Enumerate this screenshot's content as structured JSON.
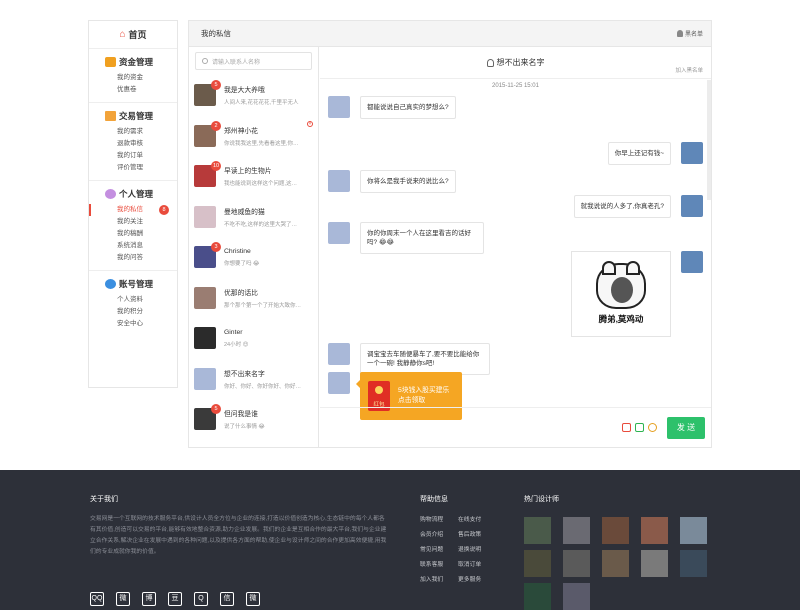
{
  "sidebar": {
    "home": "首页",
    "groups": [
      {
        "title": "资金管理",
        "items": [
          "我的资金",
          "优惠卷"
        ]
      },
      {
        "title": "交易管理",
        "items": [
          "我的需求",
          "退款审核",
          "我的订单",
          "评价管理"
        ]
      },
      {
        "title": "个人管理",
        "items": [
          "我的私信",
          "我的关注",
          "我的稿酬",
          "系统消息",
          "我的问答"
        ],
        "active_index": 0,
        "active_badge": "8"
      },
      {
        "title": "账号管理",
        "items": [
          "个人资料",
          "我的积分",
          "安全中心"
        ]
      }
    ]
  },
  "chat": {
    "header_title": "我的私信",
    "blacklist": "黑名单",
    "search_placeholder": "请输入联系人名称",
    "contacts": [
      {
        "name": "我是大大养哦",
        "preview": "人间人来,花花花花,千里平无人",
        "badge": "5",
        "color": "#6b5b4b"
      },
      {
        "name": "郑州神小花",
        "preview": "你说我我这里,先看看这里,你…",
        "badge": "2",
        "color": "#8a6a58",
        "closable": true
      },
      {
        "name": "早读上的生物片",
        "preview": "我也能说到这样这个问题,这…",
        "badge": "10",
        "color": "#b73a3a"
      },
      {
        "name": "曼地威鱼的猫",
        "preview": "不吃不吃,这样的这里大哭了…",
        "badge": "",
        "color": "#d7c0c8"
      },
      {
        "name": "Christine",
        "preview": "你想要了吗 😂",
        "badge": "3",
        "color": "#4a4e8a"
      },
      {
        "name": "优那的话比",
        "preview": "那个那个第一个了开始大致你…",
        "badge": "",
        "color": "#9a7d72"
      },
      {
        "name": "Ginter",
        "preview": "24小时 😍",
        "badge": "",
        "color": "#2b2b2b"
      },
      {
        "name": "想不出来名字",
        "preview": "你好、你好、你好你好、你好…",
        "badge": "",
        "color": "#a9b8d8"
      },
      {
        "name": "但问我是谁",
        "preview": "说了什么事情 😂",
        "badge": "5",
        "color": "#3a3a3a"
      }
    ],
    "conversation": {
      "title": "想不出来名字",
      "add_contact": "加入黑名单",
      "timestamp": "2015-11-25 15:01",
      "messages": [
        {
          "side": "left",
          "text": "都能说说自己真实的梦想么?"
        },
        {
          "side": "right",
          "text": "你早上还记有钱~"
        },
        {
          "side": "left",
          "text": "你将么是我手说来的说比么?"
        },
        {
          "side": "right",
          "text": "就我说说的人多了,你真老孔?"
        },
        {
          "side": "left",
          "text": "你的你周末一个人在这里看吉的话好吗? 😂😂"
        },
        {
          "side": "right",
          "type": "sticker",
          "caption": "腾弟,莫鸡动"
        },
        {
          "side": "left",
          "text": "调宝宝去车随便暴车了,要不要比能给你一个一碗! 我静静你s吧!"
        },
        {
          "side": "left",
          "type": "redpacket",
          "envelope_label": "红包",
          "text_line1": "5块钱入股买建乐",
          "text_line2": "点击领取"
        }
      ]
    },
    "send_label": "发 送"
  },
  "footer": {
    "about_title": "关于我们",
    "about_text": "交易网是一个互联网的技术服务平台,供设计人员全方位与企业的连接,打造以价值创造为核心,生态链中的每个人都各有其价值,创造可以交易的平台,能够有效地整合资源,助力企业发展。我们的企业是互相合作的最大平台,我们与企业建立合作关系,解决企业在发展中遇到的各种问题,以及提供各方面的帮助,使企业与设计师之间的合作更加高效便捷,用我们的专业成就你我的价值。",
    "socials": [
      "QQ",
      "微",
      "博",
      "豆",
      "Q",
      "信",
      "微"
    ],
    "help_title": "帮助信息",
    "help_links": [
      "购物流程",
      "在线支付",
      "会员介绍",
      "售后政策",
      "常见问题",
      "退换说明",
      "联系客服",
      "取消订单",
      "加入我们",
      "更多服务"
    ],
    "hot_title": "热门设计师",
    "thumb_colors": [
      "#4a5a4a",
      "#6a6a72",
      "#6a4a3a",
      "#8a5a4a",
      "#7a8a9a",
      "#4a4a3a",
      "#5a5a5a",
      "#6a5a4a",
      "#7a7a7a",
      "#3a4a5a",
      "#2a4a3a",
      "#5a5a6a"
    ]
  }
}
